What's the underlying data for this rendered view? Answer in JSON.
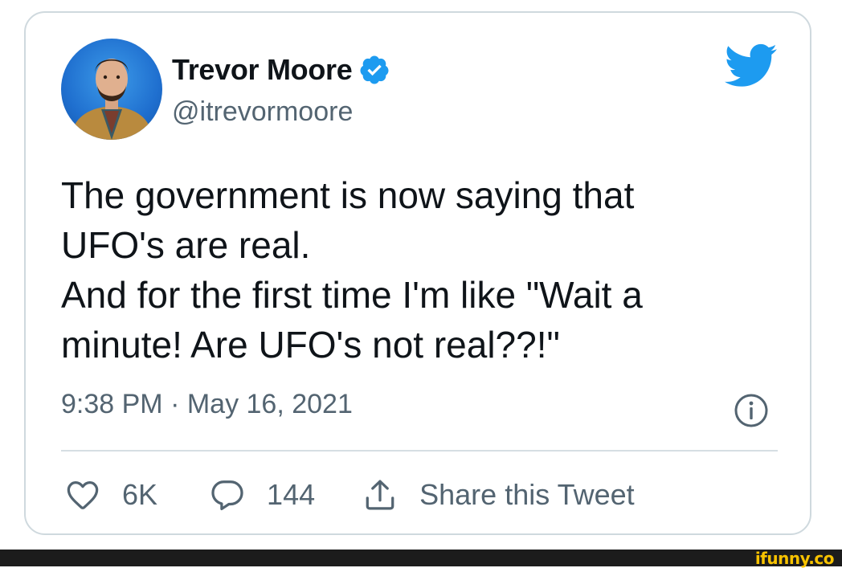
{
  "user": {
    "name": "Trevor Moore",
    "handle": "@itrevormoore"
  },
  "tweet": {
    "text": "The government is now saying that\nUFO's are real.\nAnd for the first time I'm like \"Wait a\nminute! Are UFO's not real??!\"",
    "timestamp": "9:38 PM · May 16, 2021"
  },
  "actions": {
    "likes": "6K",
    "replies": "144",
    "share_label": "Share this Tweet"
  },
  "icons": {
    "verified": "verified-badge-icon",
    "brand": "twitter-bird-icon",
    "info": "info-icon",
    "like": "heart-icon",
    "reply": "reply-bubble-icon",
    "share": "share-upload-icon"
  },
  "colors": {
    "brand_blue": "#1d9bf0",
    "text_primary": "#0f1419",
    "text_secondary": "#536471",
    "border": "#cfd9de",
    "watermark": "#f7c200"
  },
  "watermark": "ifunny.co"
}
